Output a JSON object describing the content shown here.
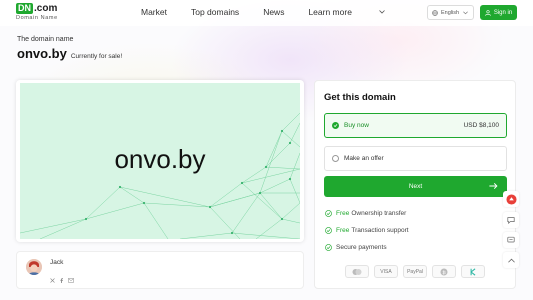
{
  "header": {
    "logo": {
      "mark": "DN",
      "suffix": ".com",
      "subtitle": "Domain Name"
    },
    "nav": [
      {
        "label": "Market"
      },
      {
        "label": "Top domains"
      },
      {
        "label": "News"
      },
      {
        "label": "Learn more"
      }
    ],
    "language": "English",
    "sign_in": "Sign in"
  },
  "domain": {
    "section_label": "The domain name",
    "name": "onvo.by",
    "status": "Currently for sale!",
    "preview_text": "onvo.by"
  },
  "seller": {
    "name": "Jack",
    "socials": [
      "x-icon",
      "facebook-icon",
      "email-icon"
    ]
  },
  "purchase": {
    "title": "Get this domain",
    "options": [
      {
        "label": "Buy now",
        "price": "USD $8,100",
        "selected": true
      },
      {
        "label": "Make an offer",
        "selected": false
      }
    ],
    "next_label": "Next",
    "features": [
      {
        "highlight": "Free",
        "text": "Ownership transfer"
      },
      {
        "highlight": "Free",
        "text": "Transaction support"
      },
      {
        "highlight": "",
        "text": "Secure payments"
      }
    ],
    "payments": [
      "",
      "VISA",
      "PayPal",
      "",
      ""
    ]
  },
  "colors": {
    "accent": "#1fa82f",
    "preview_bg": "#d7f5e4"
  }
}
